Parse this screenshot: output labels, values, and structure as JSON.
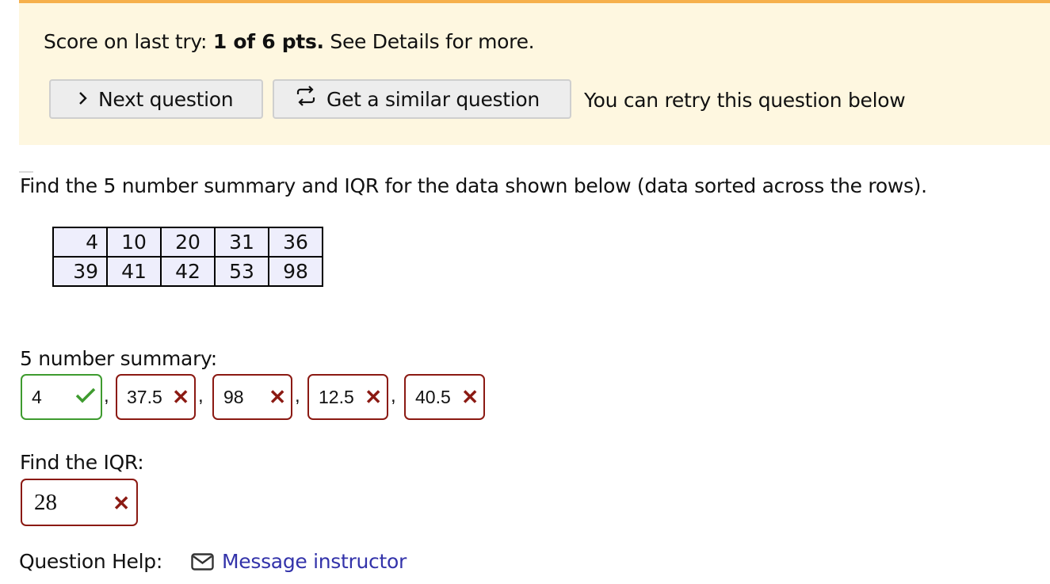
{
  "banner": {
    "score_prefix": "Score on last try:",
    "score_value": "1 of 6 pts.",
    "score_suffix": "See Details for more.",
    "next_button": {
      "label": "Next question",
      "icon": "chevron-right-icon"
    },
    "similar_button": {
      "label": "Get a similar question",
      "icon": "refresh-arrows-icon"
    },
    "retry_note": "You can retry this question below"
  },
  "question": {
    "prompt": "Find the 5 number summary and IQR for the data shown below (data sorted across the rows).",
    "data_table": [
      [
        "4",
        "10",
        "20",
        "31",
        "36"
      ],
      [
        "39",
        "41",
        "42",
        "53",
        "98"
      ]
    ]
  },
  "summary": {
    "label": "5 number summary:",
    "separator": ",",
    "answers": [
      {
        "value": "4",
        "status": "correct"
      },
      {
        "value": "37.5",
        "status": "incorrect"
      },
      {
        "value": "98",
        "status": "incorrect"
      },
      {
        "value": "12.5",
        "status": "incorrect"
      },
      {
        "value": "40.5",
        "status": "incorrect"
      }
    ]
  },
  "iqr": {
    "label": "Find the IQR:",
    "value": "28",
    "status": "incorrect"
  },
  "help": {
    "label": "Question Help:",
    "link_label": "Message instructor",
    "link_icon": "envelope-icon"
  },
  "colors": {
    "banner_bg": "#fef7e0",
    "banner_border": "#f6b04c",
    "correct": "#3e9b2f",
    "incorrect": "#8b1a13",
    "link": "#3333aa",
    "table_bg": "#eeeefc"
  }
}
